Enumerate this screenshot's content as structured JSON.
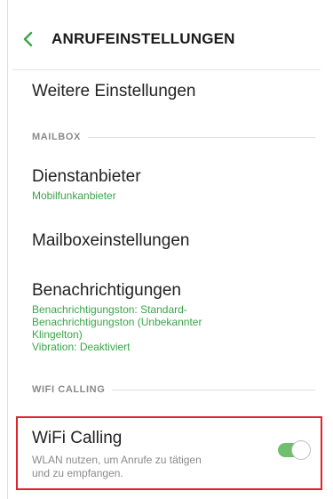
{
  "header": {
    "title": "ANRUFEINSTELLUNGEN"
  },
  "items": {
    "weitere": {
      "title": "Weitere Einstellungen"
    },
    "dienstanbieter": {
      "title": "Dienstanbieter",
      "subtitle": "Mobilfunkanbieter"
    },
    "mailboxeinstellungen": {
      "title": "Mailboxeinstellungen"
    },
    "benachrichtigungen": {
      "title": "Benachrichtigungen",
      "subtitle_lines": [
        "Benachrichtigungston: Standard-",
        "Benachrichtigungston (Unbekannter",
        "Klingelton)",
        "Vibration: Deaktiviert"
      ]
    }
  },
  "sections": {
    "mailbox": "MAILBOX",
    "wifi_calling": "WIFI CALLING"
  },
  "wifi": {
    "title": "WiFi Calling",
    "description_lines": [
      "WLAN nutzen, um Anrufe zu tätigen",
      "und zu empfangen."
    ],
    "enabled": true
  },
  "colors": {
    "accent_green": "#3aa549",
    "highlight_red": "#e0242b",
    "toggle_on": "#6fbf6f"
  },
  "icons": {
    "back": "chevron-left-icon"
  }
}
